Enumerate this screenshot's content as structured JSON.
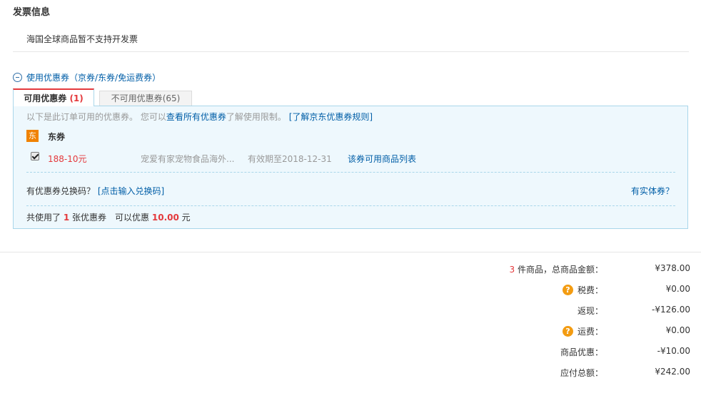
{
  "invoice": {
    "title": "发票信息",
    "note": "海国全球商品暂不支持开发票"
  },
  "coupons": {
    "toggle_label": "使用优惠券（京券/东券/免运费券）",
    "tabs": {
      "available_label": "可用优惠券",
      "available_count": "(1)",
      "unavailable_label": "不可用优惠券",
      "unavailable_count": "(65)"
    },
    "intro_text": "以下是此订单可用的优惠券。 您可以",
    "intro_link": "查看所有优惠券",
    "intro_text2": "了解使用限制。",
    "rules_link": "[了解京东优惠券规则]",
    "group_badge": "东",
    "group_title": "东券",
    "items": [
      {
        "checked": true,
        "amount": "188-10元",
        "shop": "宠爱有家宠物食品海外...",
        "expiry": "有效期至2018-12-31",
        "products_link": "该券可用商品列表"
      }
    ],
    "redeem_prompt": "有优惠券兑换码？",
    "redeem_link": "[点击输入兑换码]",
    "physical_link": "有实体券？",
    "summary_prefix": "共使用了",
    "summary_count": "1",
    "summary_mid": "张优惠券　可以优惠",
    "summary_amount": "10.00",
    "summary_suffix": "元"
  },
  "totals": {
    "item_count": "3",
    "item_count_label": "件商品，总商品金额：",
    "rows": [
      {
        "label": "税费：",
        "value": "¥0.00",
        "help": true
      },
      {
        "label": "返现：",
        "value": "-¥126.00",
        "help": false
      },
      {
        "label": "运费：",
        "value": "¥0.00",
        "help": true
      },
      {
        "label": "商品优惠：",
        "value": "-¥10.00",
        "help": false
      },
      {
        "label": "应付总额：",
        "value": "¥242.00",
        "help": false
      }
    ],
    "goods_total": "¥378.00",
    "help_glyph": "?"
  },
  "colors": {
    "accent_red": "#e4393c",
    "link_blue": "#005ea7",
    "panel_bg": "#eef8fd",
    "panel_border": "#a9d6ea",
    "help_orange": "#f39c12"
  }
}
